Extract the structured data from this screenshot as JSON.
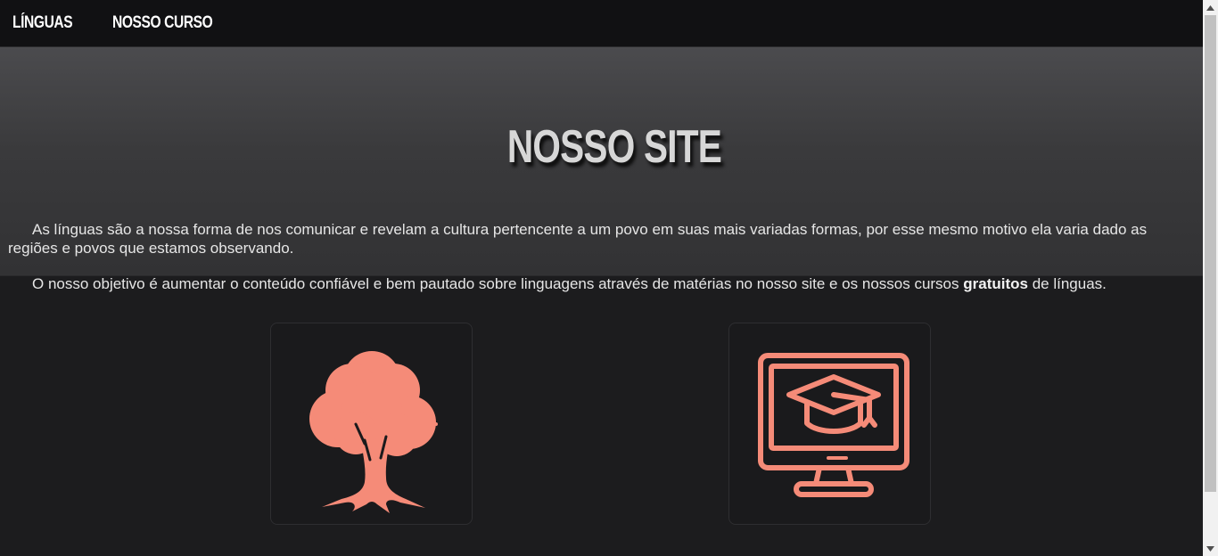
{
  "nav": {
    "items": [
      {
        "label": "LÍNGUAS"
      },
      {
        "label": "NOSSO CURSO"
      }
    ]
  },
  "hero": {
    "title": "NOSSO SITE",
    "paragraph1": "As línguas são a nossa forma de nos comunicar e revelam a cultura pertencente a um povo em suas mais variadas formas, por esse mesmo motivo ela varia dado as regiões e povos que estamos observando.",
    "paragraph2_before": "O nosso objetivo é aumentar o conteúdo confiável e bem pautado sobre linguagens através de matérias no nosso site e os nossos cursos ",
    "paragraph2_bold": "gratuitos",
    "paragraph2_after": " de línguas."
  },
  "cards": [
    {
      "icon": "tree-icon"
    },
    {
      "icon": "online-course-monitor-icon"
    }
  ],
  "colors": {
    "accent": "#f58b78",
    "nav_bg": "#111113",
    "page_bg": "#1c1c1e",
    "hero_top": "#4b4b4e",
    "hero_bottom": "#323234"
  }
}
